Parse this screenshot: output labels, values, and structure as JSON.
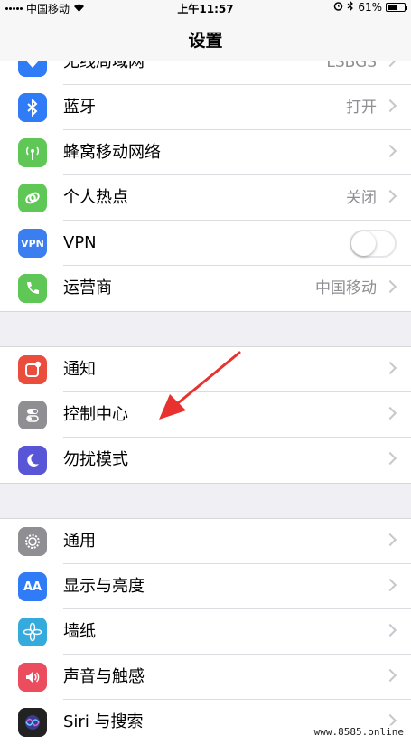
{
  "status_bar": {
    "carrier": "中国移动",
    "time": "上午11:57",
    "battery": "61%",
    "battery_level": 0.61
  },
  "nav": {
    "title": "设置"
  },
  "partial_row": {
    "label": "无线局域网",
    "value": "LSBGS",
    "icon": "wifi-icon",
    "color": "#2f7cf6"
  },
  "group1": [
    {
      "name": "bluetooth",
      "label": "蓝牙",
      "value": "打开",
      "icon": "bluetooth-icon",
      "color": "#2f7cf6"
    },
    {
      "name": "cellular",
      "label": "蜂窝移动网络",
      "value": "",
      "icon": "antenna-icon",
      "color": "#5ec756"
    },
    {
      "name": "hotspot",
      "label": "个人热点",
      "value": "关闭",
      "icon": "link-icon",
      "color": "#5ec756"
    },
    {
      "name": "vpn",
      "label": "VPN",
      "value": "",
      "icon": "vpn-icon",
      "color": "#3a7ef0",
      "icon_text": "VPN",
      "toggle_on": false
    },
    {
      "name": "carrier",
      "label": "运营商",
      "value": "中国移动",
      "icon": "phone-icon",
      "color": "#5ec756"
    }
  ],
  "group2": [
    {
      "name": "notifications",
      "label": "通知",
      "icon": "notification-icon",
      "color": "#eb4d3d"
    },
    {
      "name": "control-center",
      "label": "控制中心",
      "icon": "switches-icon",
      "color": "#8e8e93"
    },
    {
      "name": "do-not-disturb",
      "label": "勿扰模式",
      "icon": "moon-icon",
      "color": "#5856d6"
    }
  ],
  "group3": [
    {
      "name": "general",
      "label": "通用",
      "icon": "gear-icon",
      "color": "#8e8e93"
    },
    {
      "name": "display",
      "label": "显示与亮度",
      "icon": "text-size-icon",
      "color": "#2f7cf6",
      "icon_text": "AA"
    },
    {
      "name": "wallpaper",
      "label": "墙纸",
      "icon": "flower-icon",
      "color": "#35aadc"
    },
    {
      "name": "sounds",
      "label": "声音与触感",
      "icon": "speaker-icon",
      "color": "#eb4d5f"
    },
    {
      "name": "siri",
      "label": "Siri 与搜索",
      "icon": "siri-icon",
      "color": "#222"
    }
  ],
  "watermark": "www.8585.online"
}
